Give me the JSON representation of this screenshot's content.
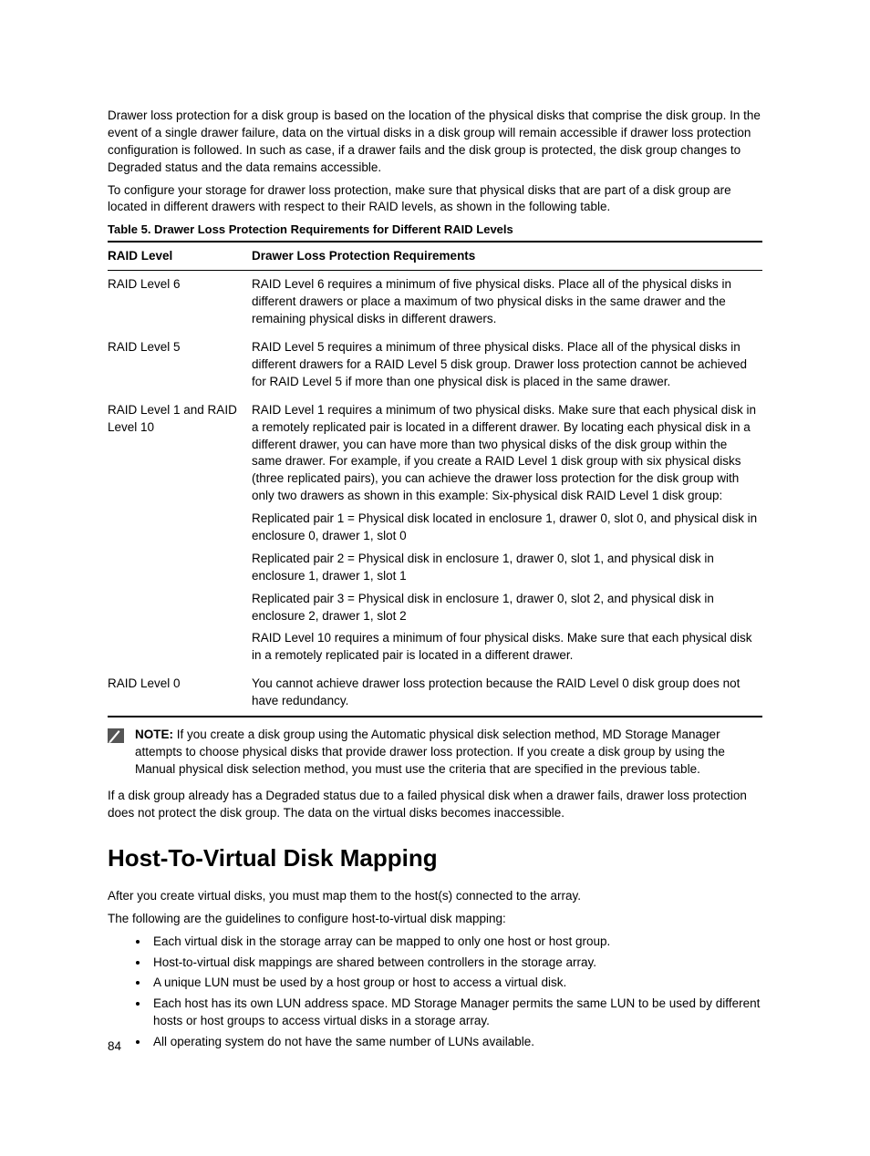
{
  "intro": {
    "p1": "Drawer loss protection for a disk group is based on the location of the physical disks that comprise the disk group. In the event of a single drawer failure, data on the virtual disks in a disk group will remain accessible if drawer loss protection configuration is followed. In such as case, if a drawer fails and the disk group is protected, the disk group changes to Degraded status and the data remains accessible.",
    "p2": "To configure your storage for drawer loss protection, make sure that physical disks that are part of a disk group are located in different drawers with respect to their RAID levels, as shown in the following table."
  },
  "table": {
    "caption": "Table 5. Drawer Loss Protection Requirements for Different RAID Levels",
    "head": {
      "c1": "RAID Level",
      "c2": "Drawer Loss Protection Requirements"
    },
    "rows": [
      {
        "level": "RAID Level 6",
        "blocks": [
          "RAID Level 6 requires a minimum of five physical disks. Place all of the physical disks in different drawers or place a maximum of two physical disks in the same drawer and the remaining physical disks in different drawers."
        ]
      },
      {
        "level": "RAID Level 5",
        "blocks": [
          "RAID Level 5 requires a minimum of three physical disks. Place all of the physical disks in different drawers for a RAID Level 5 disk group. Drawer loss protection cannot be achieved for RAID Level 5 if more than one physical disk is placed in the same drawer."
        ]
      },
      {
        "level": "RAID Level 1 and RAID Level 10",
        "blocks": [
          "RAID Level 1 requires a minimum of two physical disks. Make sure that each physical disk in a remotely replicated pair is located in a different drawer. By locating each physical disk in a different drawer, you can have more than two physical disks of the disk group within the same drawer. For example, if you create a RAID Level 1 disk group with six physical disks (three replicated pairs), you can achieve the drawer loss protection for the disk group with only two drawers as shown in this example: Six-physical disk RAID Level 1 disk group:",
          "Replicated pair 1 = Physical disk located in enclosure 1, drawer 0, slot 0, and physical disk in enclosure 0, drawer 1, slot 0",
          "Replicated pair 2 = Physical disk in enclosure 1, drawer 0, slot 1, and physical disk in enclosure 1, drawer 1, slot 1",
          "Replicated pair 3 = Physical disk in enclosure 1, drawer 0, slot 2, and physical disk in enclosure 2, drawer 1, slot 2",
          "RAID Level 10 requires a minimum of four physical disks. Make sure that each physical disk in a remotely replicated pair is located in a different drawer."
        ]
      },
      {
        "level": "RAID Level 0",
        "blocks": [
          "You cannot achieve drawer loss protection because the RAID Level 0 disk group does not have redundancy."
        ]
      }
    ]
  },
  "note": {
    "label": "NOTE:",
    "text": " If you create a disk group using the Automatic physical disk selection method, MD Storage Manager attempts to choose physical disks that provide drawer loss protection. If you create a disk group by using the Manual physical disk selection method, you must use the criteria that are specified in the previous table."
  },
  "afterNote": "If a disk group already has a Degraded status due to a failed physical disk when a drawer fails, drawer loss protection does not protect the disk group. The data on the virtual disks becomes inaccessible.",
  "section": {
    "heading": "Host-To-Virtual Disk Mapping",
    "p1": "After you create virtual disks, you must map them to the host(s) connected to the array.",
    "p2": "The following are the guidelines to configure host-to-virtual disk mapping:",
    "bullets": [
      "Each virtual disk in the storage array can be mapped to only one host or host group.",
      "Host-to-virtual disk mappings are shared between controllers in the storage array.",
      "A unique LUN must be used by a host group or host to access a virtual disk.",
      "Each host has its own LUN address space. MD Storage Manager permits the same LUN to be used by different hosts or host groups to access virtual disks in a storage array.",
      "All operating system do not have the same number of LUNs available."
    ]
  },
  "pageNumber": "84"
}
